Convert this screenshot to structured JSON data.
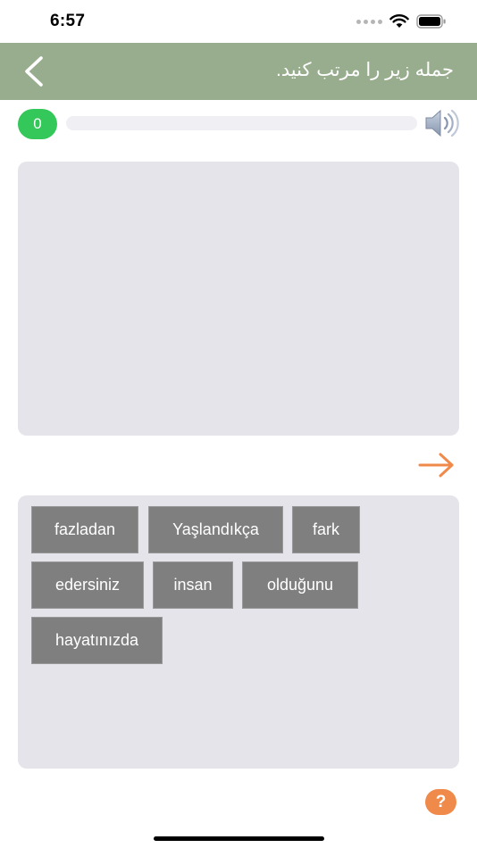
{
  "status_bar": {
    "time": "6:57"
  },
  "header": {
    "title": "جمله زیر را مرتب کنید.",
    "back_icon": "chevron-left-icon",
    "background_color": "#98ad8e"
  },
  "progress": {
    "score": "0",
    "fraction": 0,
    "speaker_icon": "speaker-icon",
    "accent_color": "#34c759"
  },
  "answer_area": {
    "words": []
  },
  "next": {
    "icon": "arrow-right-icon",
    "color": "#f08a4b"
  },
  "word_bank": {
    "words": [
      "fazladan",
      "Yaşlandıkça",
      "fark",
      "edersiniz",
      "insan",
      "olduğunu",
      "hayatınızda"
    ]
  },
  "help": {
    "label": "?"
  }
}
